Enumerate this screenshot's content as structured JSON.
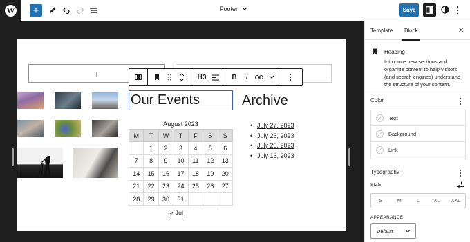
{
  "topbar": {
    "doc_title": "Footer",
    "save_label": "Save"
  },
  "canvas": {
    "search_plus": "+",
    "toolbar": {
      "heading_level": "H3",
      "bold": "B",
      "italic": "I"
    },
    "heading": "Our Events",
    "archive_title": "Archive",
    "calendar": {
      "caption": "August 2023",
      "weekdays": [
        "M",
        "T",
        "W",
        "T",
        "F",
        "S",
        "S"
      ],
      "weeks": [
        [
          "",
          "1",
          "2",
          "3",
          "4",
          "5",
          "6"
        ],
        [
          "7",
          "8",
          "9",
          "10",
          "11",
          "12",
          "13"
        ],
        [
          "14",
          "15",
          "16",
          "17",
          "18",
          "19",
          "20"
        ],
        [
          "21",
          "22",
          "23",
          "24",
          "25",
          "26",
          "27"
        ],
        [
          "28",
          "29",
          "30",
          "31",
          "",
          "",
          ""
        ]
      ],
      "prev_link": "« Jul"
    },
    "archive_links": [
      "July 27, 2023",
      "July 26, 2023",
      "July 20, 2023",
      "July 16, 2023"
    ]
  },
  "sidebar": {
    "tabs": [
      "Template",
      "Block"
    ],
    "active_tab": "Block",
    "block_title": "Heading",
    "block_desc": "Introduce new sections and organize content to help visitors (and search engines) understand the structure of your content.",
    "color_title": "Color",
    "color_items": [
      "Text",
      "Background",
      "Link"
    ],
    "typography_title": "Typography",
    "size_label": "SIZE",
    "size_options": [
      "S",
      "M",
      "L",
      "XL",
      "XXL"
    ],
    "appearance_label": "APPEARANCE",
    "appearance_value": "Default"
  },
  "colors": {
    "accent": "#2271b1",
    "selection": "#3858e9",
    "dark": "#1e1e1e"
  }
}
